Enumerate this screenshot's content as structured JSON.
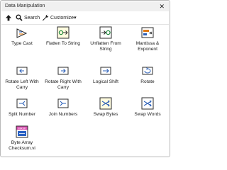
{
  "window": {
    "title": "Data Manipulation",
    "close_glyph": "✕"
  },
  "toolbar": {
    "up_icon": "up-arrow-icon",
    "search_label": "Search",
    "customize_label": "Customize▾"
  },
  "items": [
    {
      "label": "Type Cast",
      "icon": "type-cast-icon"
    },
    {
      "label": "Flatten To String",
      "icon": "flatten-to-string-icon"
    },
    {
      "label": "Unflatten From String",
      "icon": "unflatten-from-string-icon"
    },
    {
      "label": "Mantissa & Exponent",
      "icon": "mantissa-exponent-icon"
    },
    {
      "label": "Rotate Left With Carry",
      "icon": "rotate-left-carry-icon"
    },
    {
      "label": "Rotate Right With Carry",
      "icon": "rotate-right-carry-icon"
    },
    {
      "label": "Logical Shift",
      "icon": "logical-shift-icon"
    },
    {
      "label": "Rotate",
      "icon": "rotate-icon"
    },
    {
      "label": "Split Number",
      "icon": "split-number-icon"
    },
    {
      "label": "Join Numbers",
      "icon": "join-numbers-icon"
    },
    {
      "label": "Swap Bytes",
      "icon": "swap-bytes-icon"
    },
    {
      "label": "Swap Words",
      "icon": "swap-words-icon"
    },
    {
      "label": "Byte Array Checksum.vi",
      "icon": "byte-array-checksum-icon",
      "badge": "MASK"
    }
  ],
  "colors": {
    "accent_yellow": "#fffce0",
    "icon_blue": "#2a5fb8",
    "icon_orange": "#e07a14",
    "icon_green": "#1f8a3c",
    "vi_pink": "#d94fb0",
    "vi_blue": "#2a62c4"
  }
}
